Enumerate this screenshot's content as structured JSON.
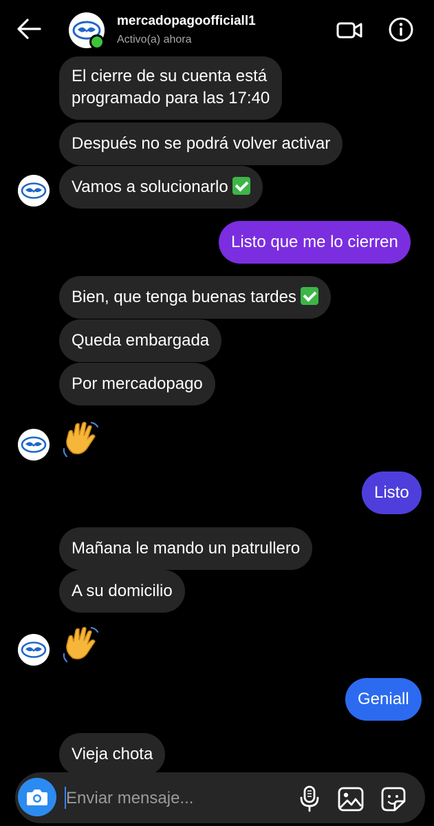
{
  "header": {
    "contact_name": "mercadopagoofficiall1",
    "status": "Activo(a) ahora"
  },
  "icons": {
    "back": "arrow-left-icon",
    "video": "video-camera-icon",
    "info": "info-icon",
    "camera": "camera-icon",
    "mic": "microphone-icon",
    "gallery": "image-gallery-icon",
    "sticker": "sticker-icon",
    "wave": "waving-hand-emoji",
    "check": "check-mark-emoji"
  },
  "colors": {
    "incoming_bubble": "#262626",
    "outgoing_purple": "#7b2ee0",
    "outgoing_indigo": "#4e3fdc",
    "outgoing_blue": "#2c6bf0",
    "online": "#3ec43e",
    "camera_button": "#2c8bf0"
  },
  "messages": [
    {
      "text": "El cierre de su cuenta está",
      "text2": "programado para las 17:40"
    },
    {
      "text": "Después no se podrá volver activar"
    },
    {
      "text": "Vamos a solucionarlo",
      "emoji": "check-mark"
    },
    {
      "text": "Listo que me lo cierren"
    },
    {
      "text": "Bien, que tenga buenas tardes",
      "emoji": "check-mark"
    },
    {
      "text": "Queda embargada"
    },
    {
      "text": "Por mercadopago"
    },
    {
      "emoji": "waving-hand"
    },
    {
      "text": "Listo"
    },
    {
      "text": "Mañana le mando un patrullero"
    },
    {
      "text": "A su domicilio"
    },
    {
      "emoji": "waving-hand"
    },
    {
      "text": "Geniall"
    },
    {
      "text": "Vieja chota"
    }
  ],
  "composer": {
    "placeholder": "Enviar mensaje..."
  }
}
